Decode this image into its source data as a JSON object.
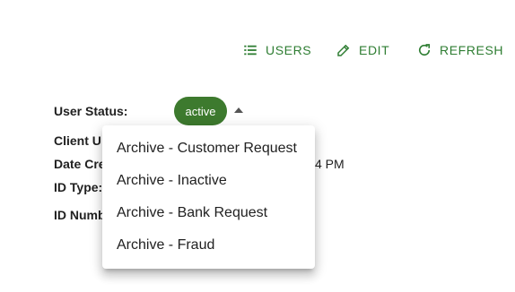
{
  "toolbar": {
    "users_label": "USERS",
    "edit_label": "EDIT",
    "refresh_label": "REFRESH",
    "users_icon": "list-icon",
    "edit_icon": "pencil-icon",
    "refresh_icon": "refresh-icon",
    "accent_color": "#2e7d32"
  },
  "details": {
    "user_status_label": "User Status:",
    "user_status_value": "active",
    "client_label": "Client U",
    "date_label": "Date Cre",
    "date_value_tail": "4 PM",
    "id_type_label": "ID Type:",
    "id_number_label": "ID Numb",
    "status_color": "#3d7a2e"
  },
  "status_menu": {
    "items": [
      "Archive - Customer Request",
      "Archive - Inactive",
      "Archive - Bank Request",
      "Archive - Fraud"
    ]
  }
}
